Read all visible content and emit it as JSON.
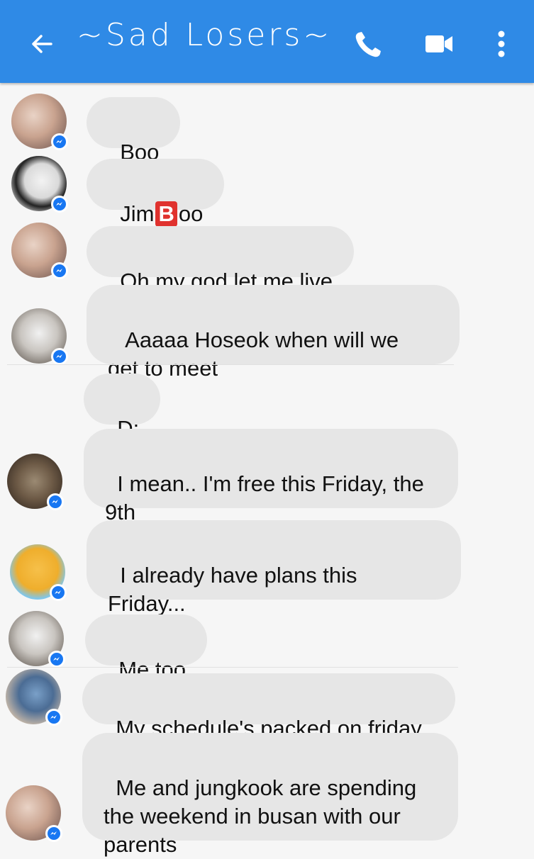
{
  "header": {
    "title": "~Sad Losers~",
    "background": "#2f8ae6",
    "icons": [
      "back-arrow-icon",
      "phone-icon",
      "video-camera-icon",
      "more-vertical-icon"
    ]
  },
  "messages": [
    {
      "text": "Boo"
    },
    {
      "text_before": "Jim",
      "text_badge": "B",
      "text_after": "oo"
    },
    {
      "text": "Oh my god let me live"
    },
    {
      "text": " Aaaaa Hoseok when will we\nget to meet"
    },
    {
      "text": "D:"
    },
    {
      "text": "I mean.. I'm free this Friday, the\n9th"
    },
    {
      "text": "I already have plans this\nFriday..."
    },
    {
      "text": "Me too"
    },
    {
      "text": "My schedule's packed on friday"
    },
    {
      "text": "Me and jungkook are spending\nthe weekend in busan with our\nparents"
    }
  ],
  "colors": {
    "bubble": "#e6e6e6",
    "badge": "#1877f2",
    "background": "#f6f6f6"
  }
}
